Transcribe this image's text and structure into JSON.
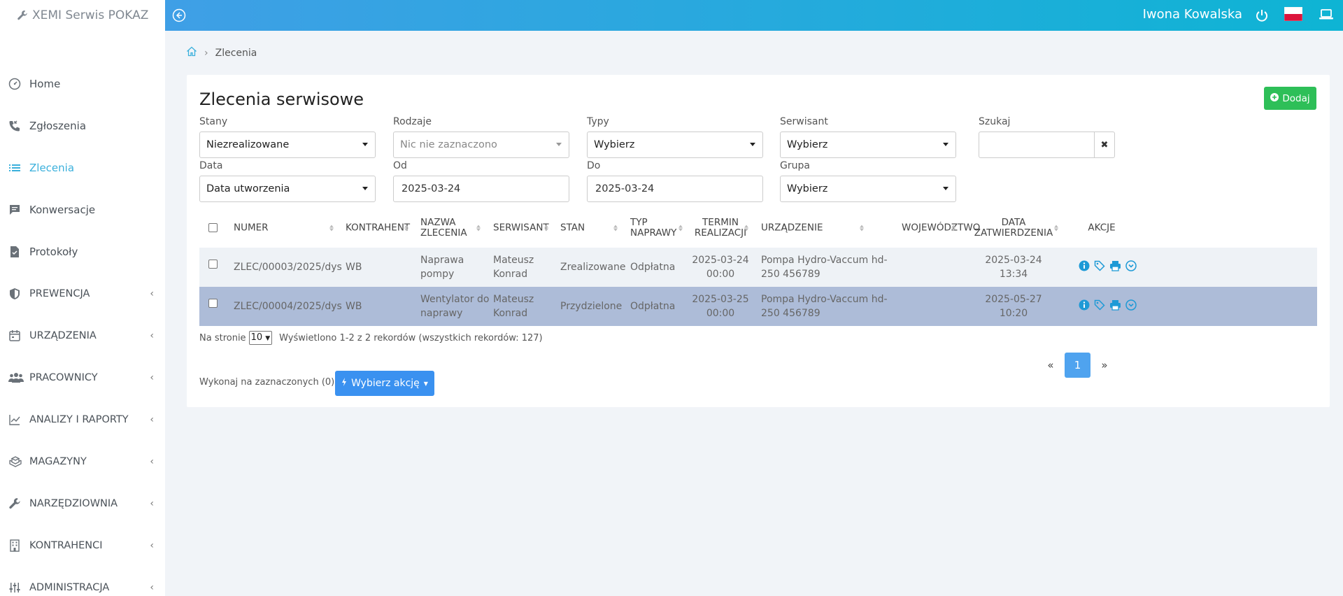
{
  "app": {
    "name": "XEMI Serwis POKAZ",
    "user": "Iwona Kowalska"
  },
  "sidebar": {
    "items": [
      {
        "label": "Home",
        "icon": "gauge-icon"
      },
      {
        "label": "Zgłoszenia",
        "icon": "phone-icon"
      },
      {
        "label": "Zlecenia",
        "icon": "list-icon",
        "active": true
      },
      {
        "label": "Konwersacje",
        "icon": "chat-icon"
      },
      {
        "label": "Protokoły",
        "icon": "document-icon"
      },
      {
        "label": "PREWENCJA",
        "icon": "shield-icon"
      },
      {
        "label": "URZĄDZENIA",
        "icon": "calendar-icon"
      },
      {
        "label": "PRACOWNICY",
        "icon": "users-icon"
      },
      {
        "label": "ANALIZY I RAPORTY",
        "icon": "chart-line-icon"
      },
      {
        "label": "MAGAZYNY",
        "icon": "boxes-icon"
      },
      {
        "label": "NARZĘDZIOWNIA",
        "icon": "wrench-icon"
      },
      {
        "label": "KONTRAHENCI",
        "icon": "building-icon"
      },
      {
        "label": "ADMINISTRACJA",
        "icon": "sliders-icon"
      }
    ]
  },
  "breadcrumb": {
    "current": "Zlecenia"
  },
  "page": {
    "title": "Zlecenia serwisowe",
    "add_label": "Dodaj"
  },
  "filters": {
    "stany": {
      "label": "Stany",
      "value": "Niezrealizowane"
    },
    "rodzaje": {
      "label": "Rodzaje",
      "value": "Nic nie zaznaczono"
    },
    "typy": {
      "label": "Typy",
      "value": "Wybierz"
    },
    "serwisant": {
      "label": "Serwisant",
      "value": "Wybierz"
    },
    "szukaj": {
      "label": "Szukaj",
      "value": ""
    },
    "data": {
      "label": "Data",
      "value": "Data utworzenia"
    },
    "od": {
      "label": "Od",
      "value": "2025-03-24"
    },
    "do": {
      "label": "Do",
      "value": "2025-03-24"
    },
    "grupa": {
      "label": "Grupa",
      "value": "Wybierz"
    }
  },
  "table": {
    "headers": {
      "numer": "NUMER",
      "kontrahent": "KONTRAHENT",
      "nazwa": [
        "NAZWA",
        "ZLECENIA"
      ],
      "serwisant": "SERWISANT",
      "stan": "STAN",
      "typ": [
        "TYP",
        "NAPRAWY"
      ],
      "termin": [
        "TERMIN",
        "REALIZACJI"
      ],
      "urzadzenie": "URZĄDZENIE",
      "wojewodztwo": "WOJEWÓDZTWO",
      "data_zatw": [
        "DATA",
        "ZATWIERDZENIA"
      ],
      "akcje": "AKCJE"
    },
    "rows": [
      {
        "numer": "ZLEC/00003/2025/dys",
        "kontrahent": "WB",
        "nazwa": [
          "Naprawa",
          "pompy"
        ],
        "serwisant": [
          "Mateusz",
          "Konrad"
        ],
        "stan": "Zrealizowane",
        "typ": "Odpłatna",
        "termin": [
          "2025-03-24",
          "00:00"
        ],
        "urzadzenie": [
          "Pompa Hydro-Vaccum hd-",
          "250 456789"
        ],
        "wojewodztwo": "",
        "data_zatw": [
          "2025-03-24",
          "13:34"
        ]
      },
      {
        "numer": "ZLEC/00004/2025/dys",
        "kontrahent": "WB",
        "nazwa": [
          "Wentylator do",
          "naprawy"
        ],
        "serwisant": [
          "Mateusz",
          "Konrad"
        ],
        "stan": "Przydzielone",
        "typ": "Odpłatna",
        "termin": [
          "2025-03-25",
          "00:00"
        ],
        "urzadzenie": [
          "Pompa Hydro-Vaccum hd-",
          "250 456789"
        ],
        "wojewodztwo": "",
        "data_zatw": [
          "2025-05-27",
          "10:20"
        ]
      }
    ]
  },
  "footer": {
    "per_page_label": "Na stronie",
    "per_page_value": "10",
    "records_info": "Wyświetlono 1-2 z 2 rekordów (wszystkich rekordów: 127)",
    "bulk_label": "Wykonaj na zaznaczonych (0):",
    "bulk_button": "Wybierz akcję"
  },
  "pagination": {
    "prev": "«",
    "current": "1",
    "next": "»"
  },
  "colors": {
    "accent": "#3bb0dc",
    "add": "#2ebf58",
    "bulk": "#3a91f0",
    "selected_row": "#adbcd8"
  }
}
